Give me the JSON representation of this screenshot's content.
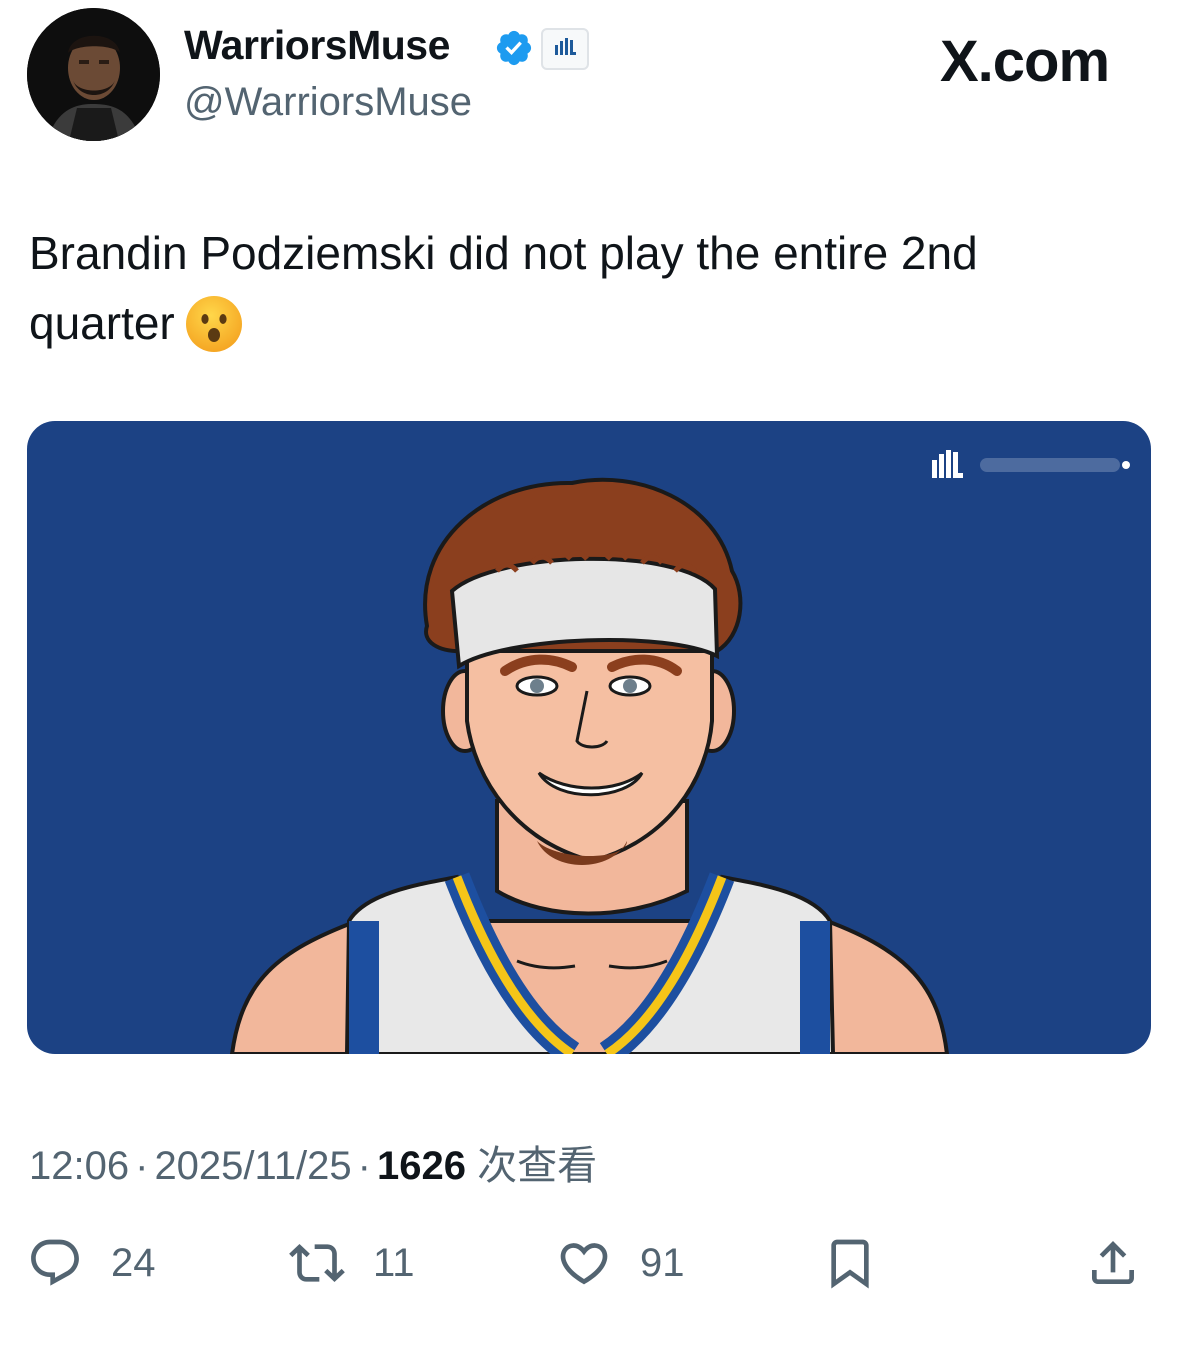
{
  "author": {
    "display_name": "WarriorsMuse",
    "handle": "@WarriorsMuse",
    "verified": true
  },
  "brand": "X.com",
  "tweet": {
    "text_line1": "Brandin Podziemski did not play the entire 2nd",
    "text_line2": "quarter"
  },
  "meta": {
    "time": "12:06",
    "date": "2025/11/25",
    "views_count": "1626",
    "views_label": "次查看",
    "separator": "·"
  },
  "actions": {
    "replies": "24",
    "reposts": "11",
    "likes": "91"
  },
  "colors": {
    "media_background": "#1c4284",
    "verified_badge": "#1d9bf0",
    "muted_text": "#536471",
    "primary_text": "#0f1419"
  },
  "icons": [
    "verified-badge-icon",
    "affiliate-badge-icon",
    "reply-icon",
    "repost-icon",
    "like-icon",
    "bookmark-icon",
    "share-icon"
  ]
}
